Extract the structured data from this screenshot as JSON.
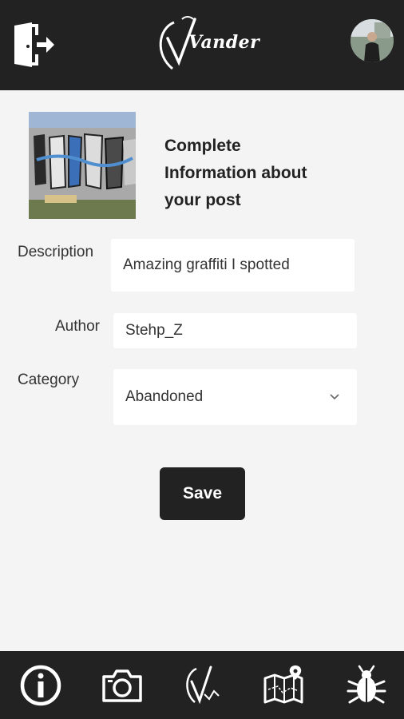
{
  "header": {
    "logo_text": "Vander",
    "exit_icon": "exit-door-icon",
    "avatar_icon": "user-avatar"
  },
  "post": {
    "title": "Complete\nInformation about\nyour post",
    "thumbnail": "graffiti-photo"
  },
  "form": {
    "description_label": "Description",
    "description_value": "Amazing graffiti I spotted",
    "author_label": "Author",
    "author_value": "Stehp_Z",
    "category_label": "Category",
    "category_value": "Abandoned"
  },
  "actions": {
    "save_label": "Save"
  },
  "bottom_nav": {
    "items": [
      "info-icon",
      "camera-icon",
      "vander-logo-icon",
      "map-icon",
      "bug-icon"
    ]
  },
  "colors": {
    "bar": "#222222",
    "background": "#f4f4f4",
    "field": "#ffffff"
  }
}
